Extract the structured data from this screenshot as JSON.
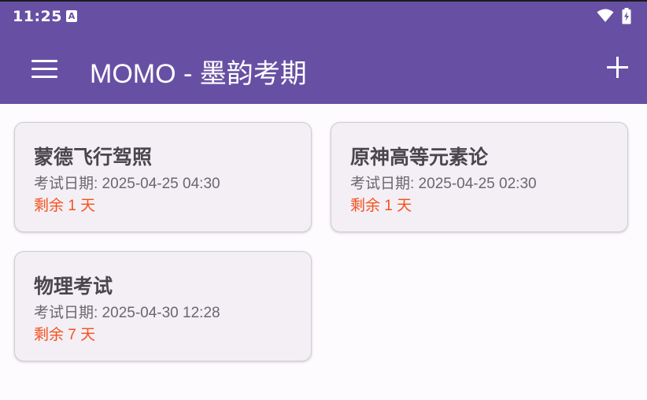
{
  "status_bar": {
    "time": "11:25",
    "notification_icon": "A",
    "wifi_icon": "wifi-icon",
    "battery_icon": "battery-charging-icon"
  },
  "app_bar": {
    "title": "MOMO - 墨韵考期",
    "menu_icon": "hamburger-menu-icon",
    "add_icon": "plus-icon"
  },
  "colors": {
    "primary": "#6750a4",
    "countdown": "#f4511e",
    "card_background": "#f3eff4"
  },
  "exams": [
    {
      "name": "蒙德飞行驾照",
      "date": "考试日期: 2025-04-25 04:30",
      "remaining": "剩余 1 天"
    },
    {
      "name": "原神高等元素论",
      "date": "考试日期: 2025-04-25 02:30",
      "remaining": "剩余 1 天"
    },
    {
      "name": "物理考试",
      "date": "考试日期: 2025-04-30 12:28",
      "remaining": "剩余 7 天"
    }
  ]
}
